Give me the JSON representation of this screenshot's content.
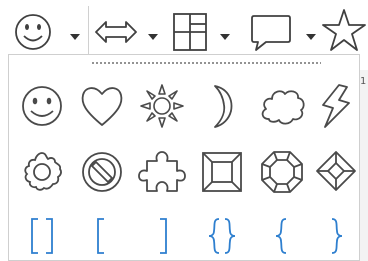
{
  "toolbar": {
    "buttons": [
      {
        "name": "smiley-face",
        "icon": "smiley-face-icon"
      },
      {
        "name": "double-arrow",
        "icon": "left-right-arrow-icon"
      },
      {
        "name": "layout",
        "icon": "layout-grid-icon"
      },
      {
        "name": "callout",
        "icon": "speech-bubble-icon"
      },
      {
        "name": "star",
        "icon": "star-icon"
      }
    ]
  },
  "ruler": {
    "marker": "1"
  },
  "popup": {
    "rows": [
      [
        "smiley-face-icon",
        "heart-icon",
        "sun-icon",
        "moon-icon",
        "cloud-icon",
        "lightning-bolt-icon"
      ],
      [
        "flower-icon",
        "no-symbol-icon",
        "puzzle-piece-icon",
        "bevel-frame-icon",
        "octagon-icon",
        "diamond-icon"
      ],
      [
        "double-bracket-icon",
        "left-bracket-icon",
        "right-bracket-icon",
        "double-brace-icon",
        "left-brace-icon",
        "right-brace-icon"
      ]
    ],
    "colors": {
      "shape": "#4a4a4a",
      "bracket": "#2e7fcf"
    }
  }
}
